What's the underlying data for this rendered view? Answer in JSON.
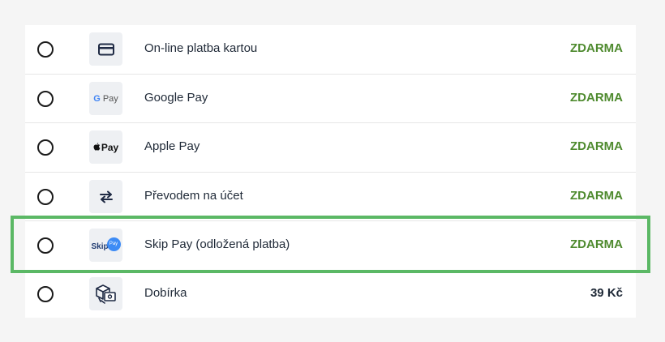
{
  "payment_methods": [
    {
      "label": "On-line platba kartou",
      "price": "ZDARMA",
      "icon": "credit-card-icon",
      "free": true,
      "selected": false
    },
    {
      "label": "Google Pay",
      "price": "ZDARMA",
      "icon": "google-pay-icon",
      "free": true,
      "selected": false,
      "icon_text": {
        "g": "G",
        "rest": "Pay"
      }
    },
    {
      "label": "Apple Pay",
      "price": "ZDARMA",
      "icon": "apple-pay-icon",
      "free": true,
      "selected": false,
      "icon_text": {
        "rest": "Pay"
      }
    },
    {
      "label": "Převodem na účet",
      "price": "ZDARMA",
      "icon": "transfer-arrows-icon",
      "free": true,
      "selected": false
    },
    {
      "label": "Skip Pay (odložená platba)",
      "price": "ZDARMA",
      "icon": "skip-pay-icon",
      "free": true,
      "selected": false,
      "highlighted": true,
      "icon_text": {
        "main": "Skip",
        "dot": "Pay"
      }
    },
    {
      "label": "Dobírka",
      "price": "39 Kč",
      "icon": "cash-on-delivery-box-icon",
      "free": false,
      "selected": false
    }
  ],
  "colors": {
    "free_price": "#4e8a2e",
    "highlight_border": "#5bb865",
    "icon_bg": "#eef0f3"
  }
}
